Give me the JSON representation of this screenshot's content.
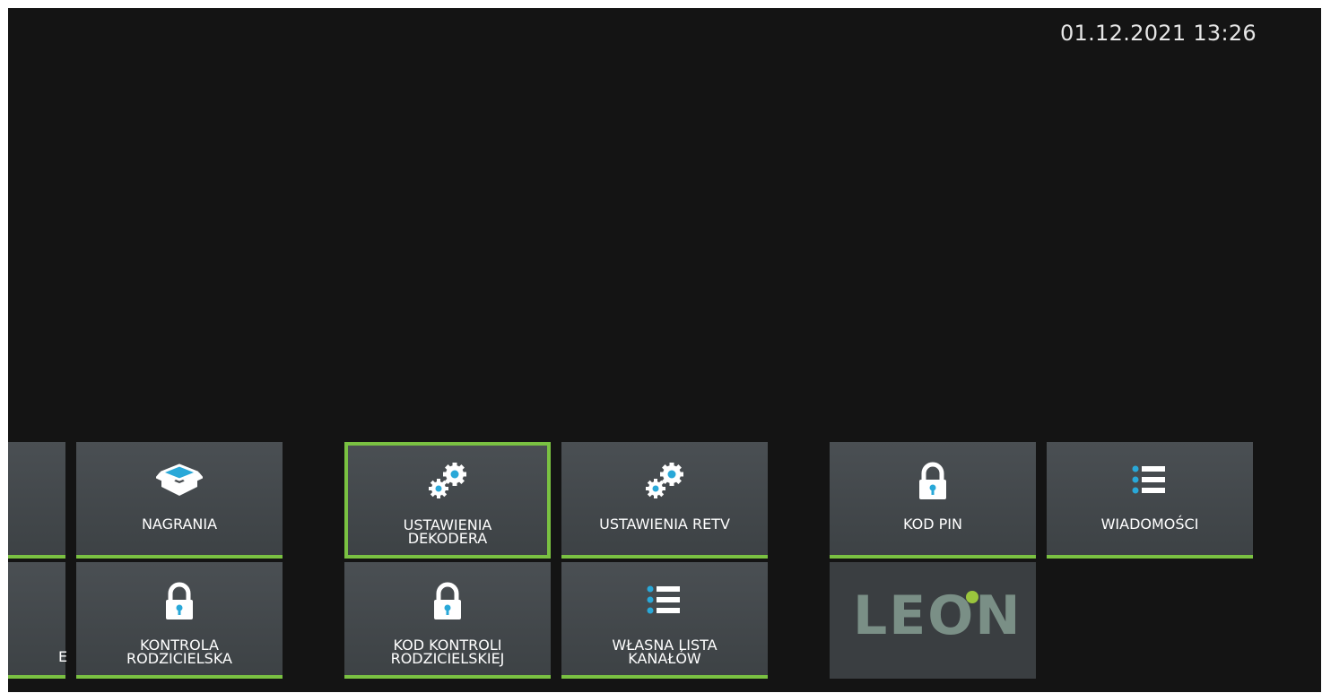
{
  "status": {
    "datetime": "01.12.2021 13:26"
  },
  "menu": {
    "row1": [
      {
        "label": "",
        "icon": "partial-tile"
      },
      {
        "label": "NAGRANIA",
        "icon": "box-open-icon"
      },
      {
        "label": "USTAWIENIA\nDEKODERA",
        "icon": "gears-icon",
        "focused": true
      },
      {
        "label": "USTAWIENIA RETV",
        "icon": "gears-icon"
      },
      {
        "label": "KOD PIN",
        "icon": "lock-icon"
      },
      {
        "label": "WIADOMOŚCI",
        "icon": "list-icon"
      }
    ],
    "row2": [
      {
        "label": "E",
        "icon": "partial-tile"
      },
      {
        "label": "KONTROLA\nRODZICIELSKA",
        "icon": "lock-icon"
      },
      {
        "label": "KOD KONTROLI\nRODZICIELSKIEJ",
        "icon": "lock-icon"
      },
      {
        "label": "WŁASNA LISTA\nKANAŁÓW",
        "icon": "list-icon"
      },
      {
        "label": "LEON",
        "icon": "leon-logo"
      }
    ]
  },
  "colors": {
    "accent": "#7ac142",
    "tile": "#42474a",
    "background": "#141414",
    "icon_accent": "#29a8d8"
  }
}
